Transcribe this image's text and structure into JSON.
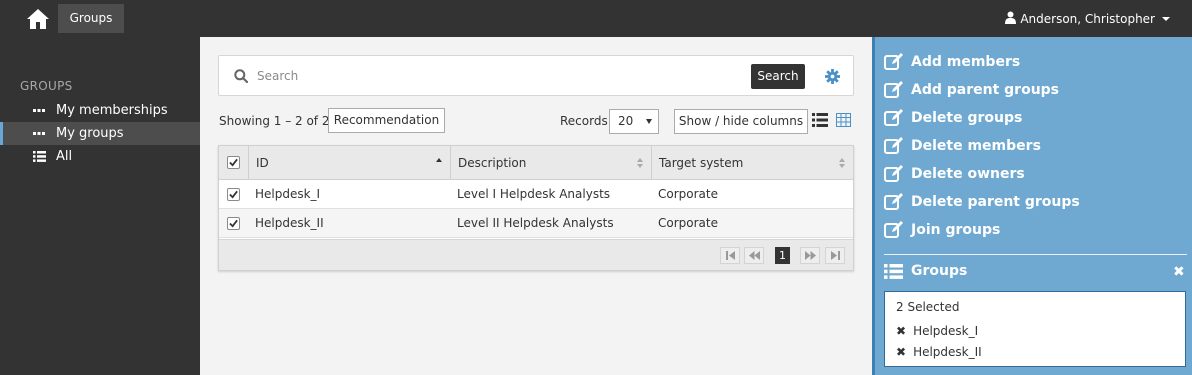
{
  "topbar": {
    "home_icon": "home-icon",
    "tab_label": "Groups",
    "user_name": "Anderson, Christopher"
  },
  "sidebar": {
    "heading": "GROUPS",
    "items": [
      {
        "label": "My memberships",
        "icon": "ellipsis-icon",
        "active": false
      },
      {
        "label": "My groups",
        "icon": "ellipsis-icon",
        "active": true
      },
      {
        "label": "All",
        "icon": "list-icon",
        "active": false
      }
    ]
  },
  "search": {
    "placeholder": "Search",
    "button_label": "Search"
  },
  "toolbar": {
    "showing_text": "Showing 1 – 2 of 2",
    "recommendation_label": "Recommendation",
    "records_label": "Records",
    "records_value": "20",
    "columns_label": "Show / hide columns"
  },
  "table": {
    "columns": [
      "ID",
      "Description",
      "Target system"
    ],
    "rows": [
      {
        "id": "Helpdesk_I",
        "description": "Level I Helpdesk Analysts",
        "target": "Corporate",
        "checked": true
      },
      {
        "id": "Helpdesk_II",
        "description": "Level II Helpdesk Analysts",
        "target": "Corporate",
        "checked": true
      }
    ],
    "current_page": "1"
  },
  "actions": [
    "Add members",
    "Add parent groups",
    "Delete groups",
    "Delete members",
    "Delete owners",
    "Delete parent groups",
    "Join groups"
  ],
  "selection": {
    "title": "Groups",
    "close": "✖",
    "count_text": "2 Selected",
    "remove_glyph": "✖",
    "items": [
      "Helpdesk_I",
      "Helpdesk_II"
    ]
  },
  "colors": {
    "topbar": "#333333",
    "panel": "#6fa9d2",
    "accent": "#3e7fb4",
    "gear": "#4a90c8"
  }
}
